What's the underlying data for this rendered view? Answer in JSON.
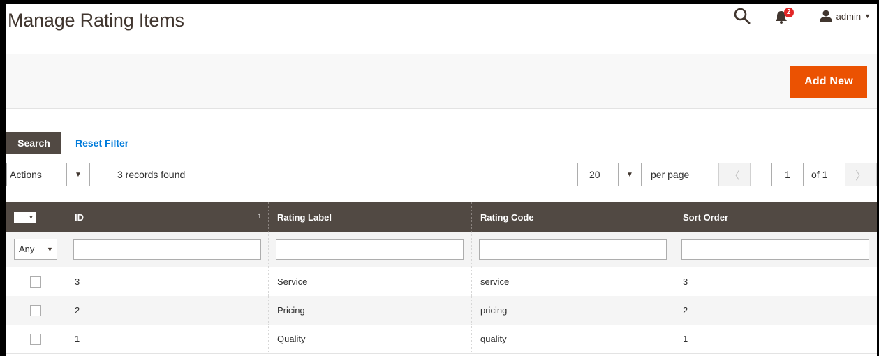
{
  "header": {
    "title": "Manage Rating Items",
    "notification_count": "2",
    "user_name": "admin"
  },
  "action_bar": {
    "add_new_label": "Add New"
  },
  "filters_bar": {
    "search_label": "Search",
    "reset_label": "Reset Filter"
  },
  "toolbar": {
    "actions_label": "Actions",
    "records_found": "3 records found",
    "per_page_value": "20",
    "per_page_label": "per page",
    "current_page": "1",
    "page_of": "of 1"
  },
  "grid": {
    "columns": [
      "ID",
      "Rating Label",
      "Rating Code",
      "Sort Order"
    ],
    "sort_indicator": "↑",
    "filter_any": "Any",
    "rows": [
      {
        "id": "3",
        "label": "Service",
        "code": "service",
        "sort": "3"
      },
      {
        "id": "2",
        "label": "Pricing",
        "code": "pricing",
        "sort": "2"
      },
      {
        "id": "1",
        "label": "Quality",
        "code": "quality",
        "sort": "1"
      }
    ]
  },
  "colors": {
    "accent": "#eb5202",
    "header_bg": "#514943",
    "link": "#007bdb",
    "badge": "#e22626"
  },
  "icons": [
    "search-icon",
    "bell-icon",
    "user-icon",
    "chevron-down-icon",
    "chevron-left-icon",
    "chevron-right-icon"
  ]
}
